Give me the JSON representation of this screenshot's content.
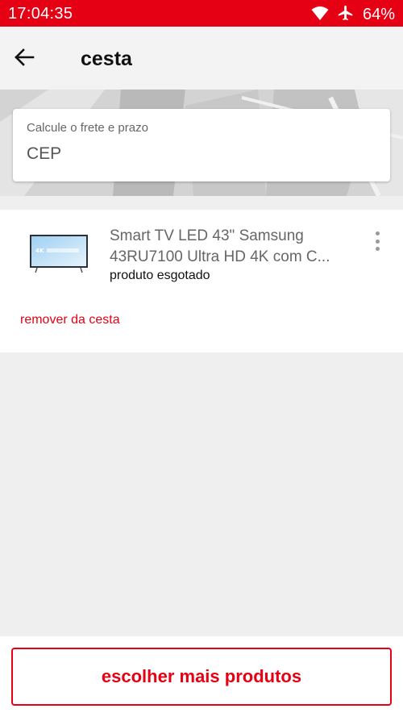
{
  "status_bar": {
    "time": "17:04:35",
    "battery": "64%",
    "icons": [
      "wifi-icon",
      "airplane-icon"
    ]
  },
  "header": {
    "back_icon": "arrow-left-icon",
    "title": "cesta"
  },
  "shipping": {
    "label": "Calcule o frete e prazo",
    "placeholder": "CEP"
  },
  "cart": {
    "items": [
      {
        "name_line1": "Smart TV LED 43\" Samsung",
        "name_line2": "43RU7100 Ultra HD 4K com C...",
        "status": "produto esgotado",
        "image_icon": "tv-icon",
        "menu_icon": "more-vertical-icon"
      }
    ],
    "remove_label": "remover da cesta"
  },
  "footer": {
    "cta_label": "escolher mais produtos"
  },
  "colors": {
    "brand": "#e60014",
    "background": "#efefef",
    "card": "#ffffff"
  }
}
